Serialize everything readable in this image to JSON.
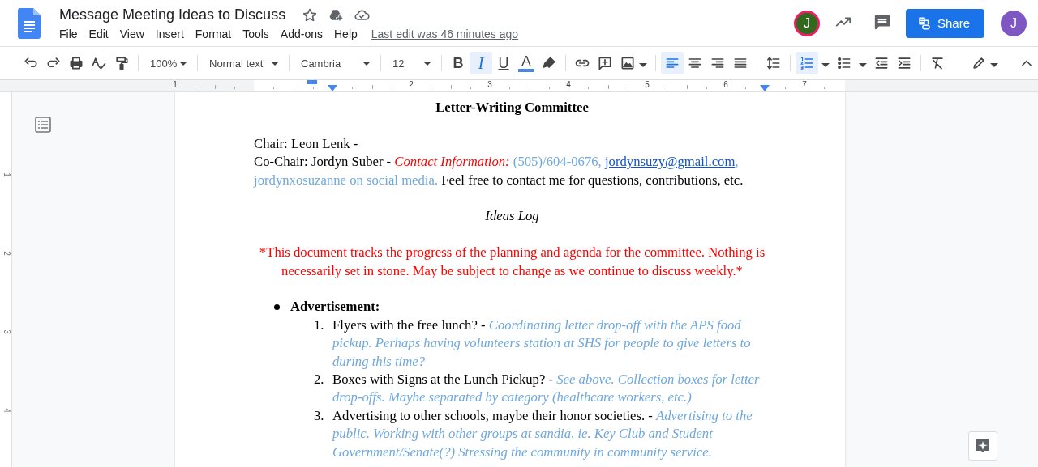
{
  "header": {
    "title": "Message Meeting Ideas to Discuss",
    "menu": [
      "File",
      "Edit",
      "View",
      "Insert",
      "Format",
      "Tools",
      "Add-ons",
      "Help"
    ],
    "last_edit": "Last edit was 46 minutes ago",
    "share": "Share",
    "avatars": [
      {
        "kind": "collaborator",
        "initial": "J",
        "color": "#33691e"
      },
      {
        "kind": "account",
        "initial": "J",
        "color": "#7e57c2"
      }
    ]
  },
  "toolbar": {
    "zoom": "100%",
    "style": "Normal text",
    "font": "Cambria",
    "size": "12",
    "format_buttons": [
      {
        "kind": "bold",
        "label": "B",
        "selected": false
      },
      {
        "kind": "italic",
        "label": "I",
        "selected": true
      },
      {
        "kind": "underline",
        "label": "U",
        "selected": false
      }
    ],
    "text_color": {
      "label": "A"
    },
    "align_buttons": [
      {
        "kind": "left",
        "selected": true
      },
      {
        "kind": "center",
        "selected": false
      },
      {
        "kind": "right",
        "selected": false
      },
      {
        "kind": "justify",
        "selected": false
      }
    ],
    "list_buttons": [
      {
        "kind": "numbered",
        "selected": true
      },
      {
        "kind": "bulleted",
        "selected": false
      }
    ]
  },
  "ruler": {
    "labels": [
      "1",
      "2",
      "3",
      "4",
      "5",
      "6",
      "7"
    ],
    "vertical_labels": [
      "1",
      "2",
      "3",
      "4"
    ]
  },
  "document": {
    "title": "Letter-Writing Committee",
    "paragraphs": [
      {
        "kind": "body",
        "runs": [
          {
            "kind": "text",
            "text": "Chair: Leon Lenk -"
          }
        ]
      },
      {
        "kind": "body",
        "runs": [
          {
            "kind": "text",
            "text": "Co-Chair: Jordyn Suber - "
          },
          {
            "kind": "label",
            "text": "Contact Information:"
          },
          {
            "kind": "contact",
            "text": " (505)/604-0676, "
          },
          {
            "kind": "link",
            "text": "jordynsuzy@gmail.com"
          },
          {
            "kind": "contact",
            "text": ", jordynxosuzanne on social media."
          },
          {
            "kind": "text",
            "text": " Feel free to contact me for questions, contributions, etc."
          }
        ]
      },
      {
        "kind": "subtitle",
        "runs": [
          {
            "kind": "subtitle",
            "text": "Ideas Log"
          }
        ]
      },
      {
        "kind": "notice",
        "runs": [
          {
            "kind": "notice",
            "text": "*This document tracks the progress of the planning and agenda for the committee. Nothing is necessarily set in stone. May be subject to change as we continue to discuss weekly.*"
          }
        ]
      }
    ],
    "list": [
      {
        "text": "Advertisement:",
        "children": [
          {
            "number": "1.",
            "runs": [
              {
                "kind": "text",
                "text": "Flyers with the free lunch? - "
              },
              {
                "kind": "note",
                "text": "Coordinating letter drop-off with the APS food pickup. Perhaps having volunteers station at SHS for people to give letters to during this time?"
              }
            ]
          },
          {
            "number": "2.",
            "runs": [
              {
                "kind": "text",
                "text": "Boxes with Signs at the Lunch Pickup? - "
              },
              {
                "kind": "note",
                "text": "See above. Collection boxes for letter drop-offs. Maybe separated by category (healthcare workers, etc.)"
              }
            ]
          },
          {
            "number": "3.",
            "runs": [
              {
                "kind": "text",
                "text": "Advertising to other schools, maybe their honor societies. - "
              },
              {
                "kind": "note",
                "text": "Advertising to the public. Working with other groups at sandia, ie. Key Club and Student Government/Senate(?) Stressing the community in community service."
              }
            ]
          }
        ]
      }
    ]
  }
}
